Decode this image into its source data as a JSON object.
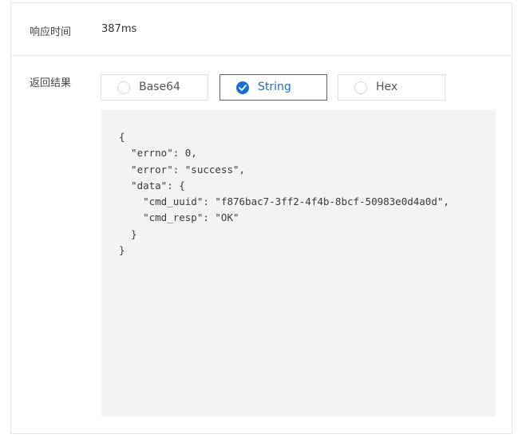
{
  "response": {
    "label": "响应时间",
    "value": "387ms"
  },
  "result": {
    "label": "返回结果",
    "format_options": [
      {
        "label": "Base64",
        "selected": false
      },
      {
        "label": "String",
        "selected": true
      },
      {
        "label": "Hex",
        "selected": false
      }
    ],
    "body": "{\n  \"errno\": 0,\n  \"error\": \"success\",\n  \"data\": {\n    \"cmd_uuid\": \"f876bac7-3ff2-4f4b-8bcf-50983e0d4a0d\",\n    \"cmd_resp\": \"OK\"\n  }\n}"
  },
  "colors": {
    "accent": "#1a6ed8",
    "border": "#e3e5e8",
    "code_background": "#f3f3f3"
  },
  "icons": {
    "selected": "check-icon",
    "unselected": "radio-empty-icon"
  }
}
